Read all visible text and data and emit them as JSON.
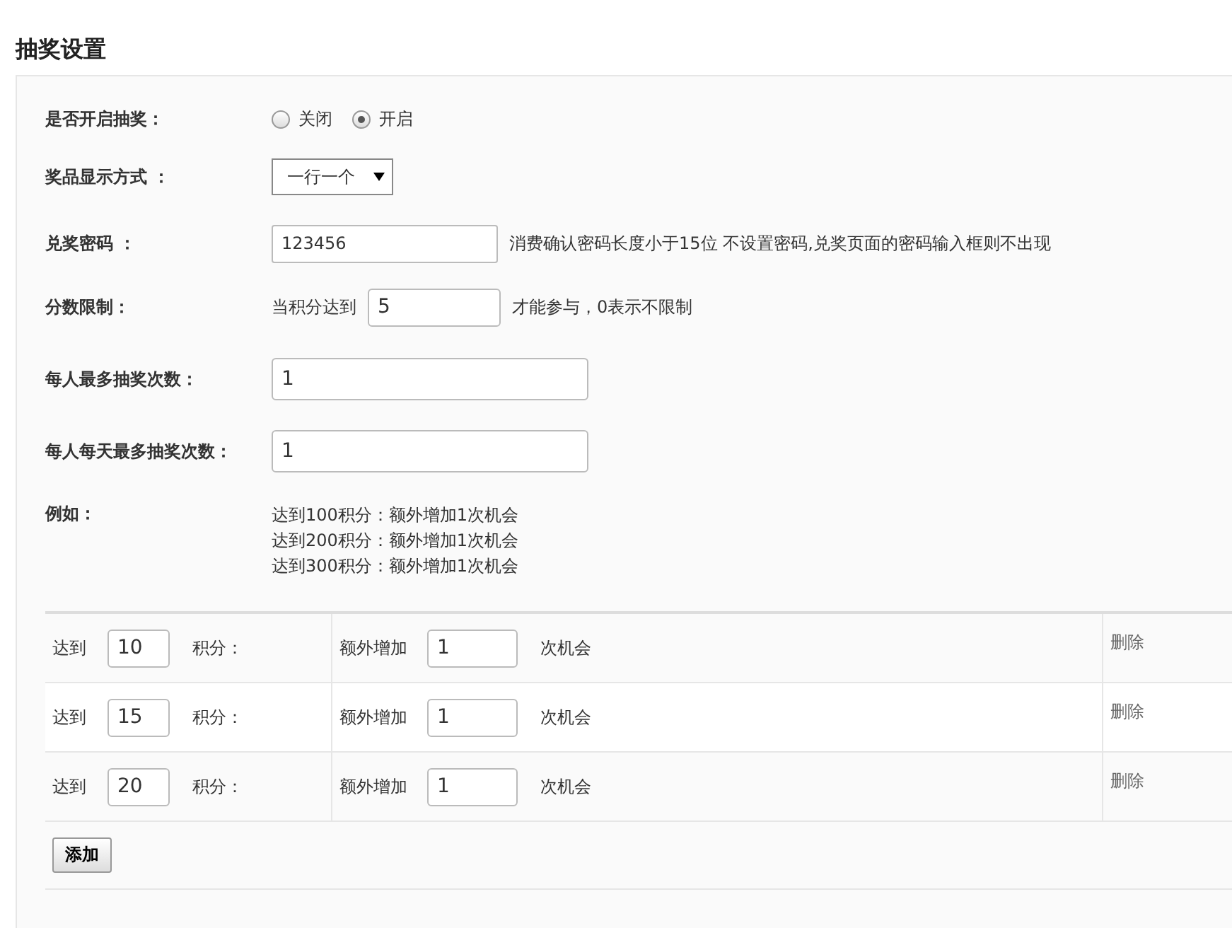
{
  "title": "抽奖设置",
  "enable": {
    "label": "是否开启抽奖：",
    "options": [
      {
        "label": "关闭",
        "selected": false
      },
      {
        "label": "开启",
        "selected": true
      }
    ]
  },
  "display": {
    "label": "奖品显示方式 ：",
    "value": "一行一个"
  },
  "password": {
    "label": "兑奖密码 ：",
    "value": "123456",
    "hint": "消费确认密码长度小于15位 不设置密码,兑奖页面的密码输入框则不出现"
  },
  "score_limit": {
    "label": "分数限制：",
    "prefix": "当积分达到",
    "value": "5",
    "suffix": "才能参与，0表示不限制"
  },
  "max_draws": {
    "label": "每人最多抽奖次数：",
    "value": "1"
  },
  "daily_max": {
    "label": "每人每天最多抽奖次数：",
    "value": "1"
  },
  "example": {
    "label": "例如：",
    "lines": [
      "达到100积分：额外增加1次机会",
      "达到200积分：额外增加1次机会",
      "达到300积分：额外增加1次机会"
    ]
  },
  "rules": [
    {
      "reach_label": "达到",
      "points": "10",
      "points_label": "积分：",
      "extra_label": "额外增加",
      "chances": "1",
      "chances_label": "次机会",
      "delete": "删除"
    },
    {
      "reach_label": "达到",
      "points": "15",
      "points_label": "积分：",
      "extra_label": "额外增加",
      "chances": "1",
      "chances_label": "次机会",
      "delete": "删除"
    },
    {
      "reach_label": "达到",
      "points": "20",
      "points_label": "积分：",
      "extra_label": "额外增加",
      "chances": "1",
      "chances_label": "次机会",
      "delete": "删除"
    }
  ],
  "add_button": "添加"
}
